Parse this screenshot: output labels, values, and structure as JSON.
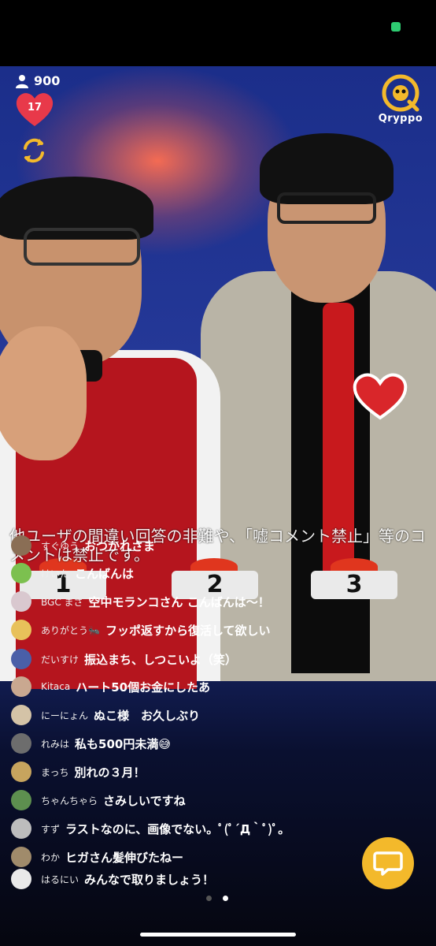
{
  "viewer_count": "900",
  "like_count": "17",
  "logo_text": "Qryppo",
  "notice": "他ユーザの間違い回答の非難や、「嘘コメント禁止」等のコメントは禁止です。",
  "buttons": [
    "1",
    "2",
    "3"
  ],
  "comments": [
    {
      "user": "すぐゆう",
      "text": "おつかれさま",
      "avatar": "#8a6e55"
    },
    {
      "user": "けいた",
      "text": "こんばんは",
      "avatar": "#7cc04f"
    },
    {
      "user": "BGC まさ",
      "text": "空中モランコさん こんばんは〜！",
      "avatar": "#d9c8cf"
    },
    {
      "user": "ありがとう🐜",
      "text": "フッポ返すから復活して欲しい",
      "avatar": "#e8c15a"
    },
    {
      "user": "だいすけ",
      "text": "振込まち、しつこいよ（笑）",
      "avatar": "#4a5fa8"
    },
    {
      "user": "Kitaca",
      "text": "ハート50個お金にしたあ",
      "avatar": "#c9a890"
    },
    {
      "user": "にーにょん",
      "text": "ぬこ様　お久しぶり",
      "avatar": "#d4c3a7"
    },
    {
      "user": "れみは",
      "text": "私も500円未満😅",
      "avatar": "#6d6d6d"
    },
    {
      "user": "まっち",
      "text": "別れの３月！",
      "avatar": "#c7a45e"
    },
    {
      "user": "ちゃんちゃら",
      "text": "さみしいですね",
      "avatar": "#5d8f4f"
    },
    {
      "user": "すず",
      "text": "ラストなのに、画像でない。ﾟ(ﾟ´Д｀ﾟ)ﾟ。",
      "avatar": "#bdbdbd"
    },
    {
      "user": "わか",
      "text": "ヒガさん髪伸びたねー",
      "avatar": "#a08b6b"
    },
    {
      "user": "はるにい",
      "text": "みんなで取りましょう！",
      "avatar": "#e9e9e9"
    }
  ],
  "pager": {
    "pages": 2,
    "active": 2
  },
  "colors": {
    "accent": "#f3b92b",
    "heart": "#e8394a",
    "status": "#2ecc71"
  }
}
